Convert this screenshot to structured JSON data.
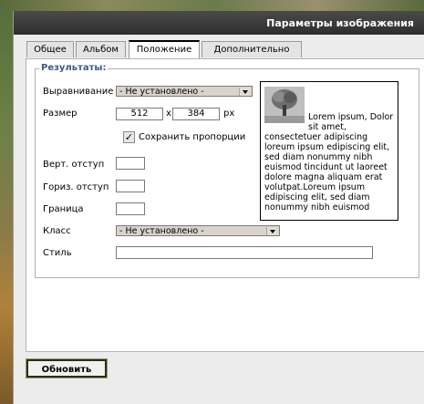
{
  "dialog": {
    "title": "Параметры изображения"
  },
  "tabs": [
    {
      "label": "Общее"
    },
    {
      "label": "Альбом"
    },
    {
      "label": "Положение",
      "active": true
    },
    {
      "label": "Дополнительно"
    }
  ],
  "results": {
    "legend": "Результаты:",
    "align_label": "Выравнивание",
    "align_value": "- Не установлено -",
    "size_label": "Размер",
    "width": "512",
    "times": "x",
    "height": "384",
    "unit": "px",
    "keep_proportions_label": "Сохранить пропорции",
    "keep_proportions_checked": true,
    "vspace_label": "Верт. отступ",
    "vspace_value": "",
    "hspace_label": "Гориз. отступ",
    "hspace_value": "",
    "border_label": "Граница",
    "border_value": "",
    "class_label": "Класс",
    "class_value": "- Не установлено -",
    "style_label": "Стиль",
    "style_value": ""
  },
  "preview": {
    "text": "Lorem ipsum, Dolor sit amet, consectetuer adipiscing loreum ipsum edipiscing elit, sed diam nonummy nibh euismod tincidunt ut laoreet dolore magna aliquam erat volutpat.Loreum ipsum edipiscing elit, sed diam nonummy nibh euismod"
  },
  "footer": {
    "update_label": "Обновить"
  },
  "icons": {
    "tree": "tree-thumbnail-icon",
    "checkmark": "checkmark-icon",
    "dropdown": "chevron-down-icon"
  }
}
